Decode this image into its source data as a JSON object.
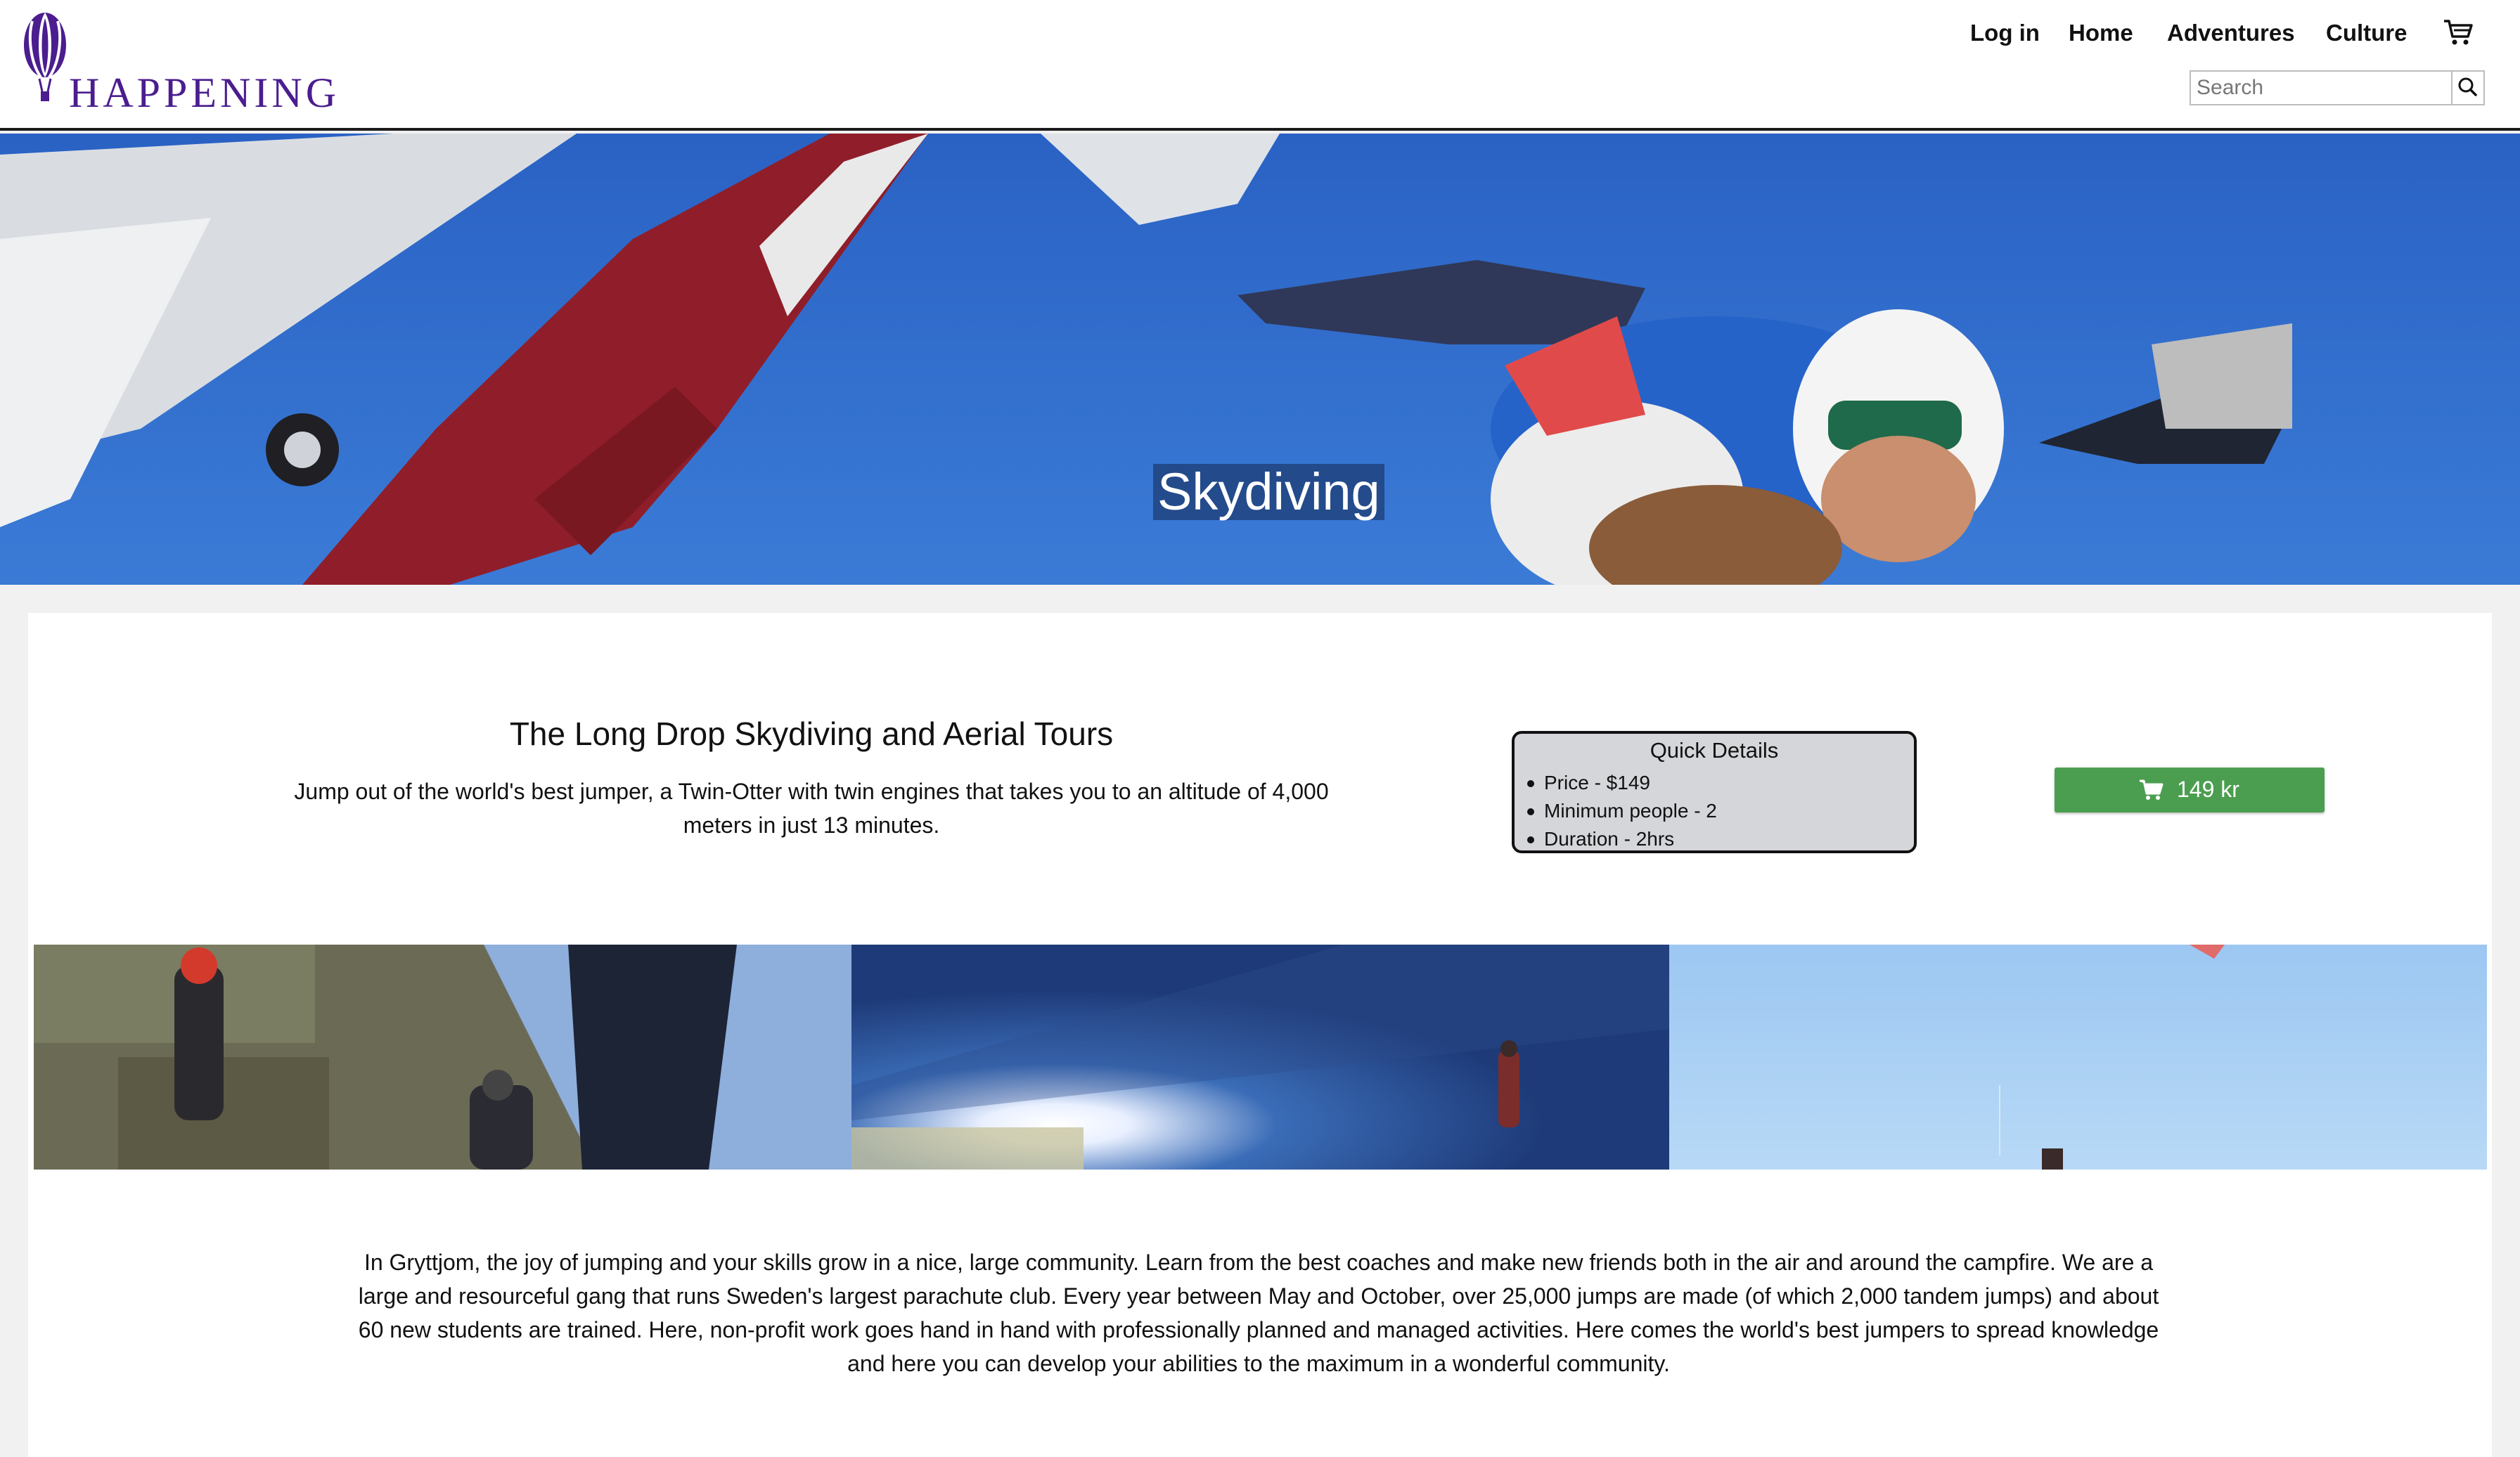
{
  "brand": {
    "name": "HAPPENING",
    "color": "#4b1d8f"
  },
  "nav": {
    "items": [
      {
        "label": "Log in"
      },
      {
        "label": "Home"
      },
      {
        "label": "Adventures"
      },
      {
        "label": "Culture"
      }
    ],
    "cart_icon": "cart-icon",
    "search": {
      "placeholder": "Search",
      "value": "",
      "icon": "search-icon"
    }
  },
  "hero": {
    "title": "Skydiving"
  },
  "tour": {
    "title": "The Long Drop Skydiving and Aerial Tours",
    "description": "Jump out of the world's best jumper, a Twin-Otter with twin engines that takes you to an altitude of 4,000 meters in just 13 minutes."
  },
  "quick_details": {
    "title": "Quick Details",
    "items": [
      "Price - $149",
      "Minimum people - 2",
      "Duration - 2hrs"
    ]
  },
  "buy_button": {
    "label": "149 kr",
    "icon": "cart-icon",
    "color": "#4b9e4f"
  },
  "body_text": "In Gryttjom, the joy of jumping and your skills grow in a nice, large community. Learn from the best coaches and make new friends both in the air and around the campfire. We are a large and resourceful gang that runs Sweden's largest parachute club. Every year between May and October, over 25,000 jumps are made (of which 2,000 tandem jumps) and about 60 new students are trained. Here, non-profit work goes hand in hand with professionally planned and managed activities. Here comes the world's best jumpers to spread knowledge and here you can develop your abilities to the maximum in a wonderful community."
}
